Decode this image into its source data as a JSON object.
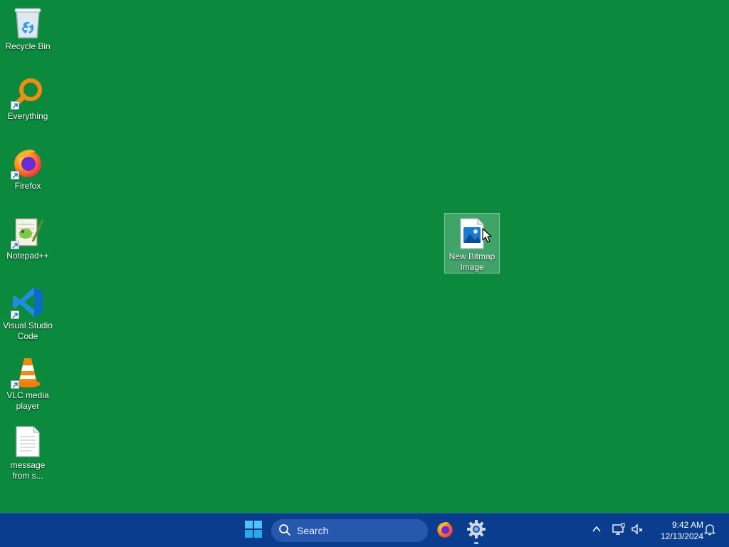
{
  "desktop": {
    "background_color": "#0b8a3e",
    "icons": [
      {
        "label": "Recycle Bin",
        "icon": "recycle-bin-icon"
      },
      {
        "label": "Everything",
        "icon": "everything-search-icon"
      },
      {
        "label": "Firefox",
        "icon": "firefox-icon"
      },
      {
        "label": "Notepad++",
        "icon": "notepad-plus-plus-icon"
      },
      {
        "label": "Visual Studio Code",
        "icon": "vscode-icon"
      },
      {
        "label": "VLC media player",
        "icon": "vlc-icon"
      },
      {
        "label": "message from s...",
        "icon": "text-file-icon"
      },
      {
        "label": "New Bitmap Image",
        "icon": "bitmap-image-icon",
        "selected": true
      }
    ]
  },
  "taskbar": {
    "background_color": "#0b3d8f",
    "search": {
      "placeholder": "Search"
    },
    "pinned": [
      {
        "name": "Start",
        "icon": "windows-start-icon"
      },
      {
        "name": "Firefox",
        "icon": "firefox-icon"
      },
      {
        "name": "Settings",
        "icon": "settings-gear-icon",
        "running": true
      }
    ],
    "tray": {
      "icons": [
        "chevron-up-icon",
        "network-icon",
        "volume-muted-icon",
        "notification-bell-icon"
      ],
      "time": "9:42 AM",
      "date": "12/13/2024"
    }
  }
}
